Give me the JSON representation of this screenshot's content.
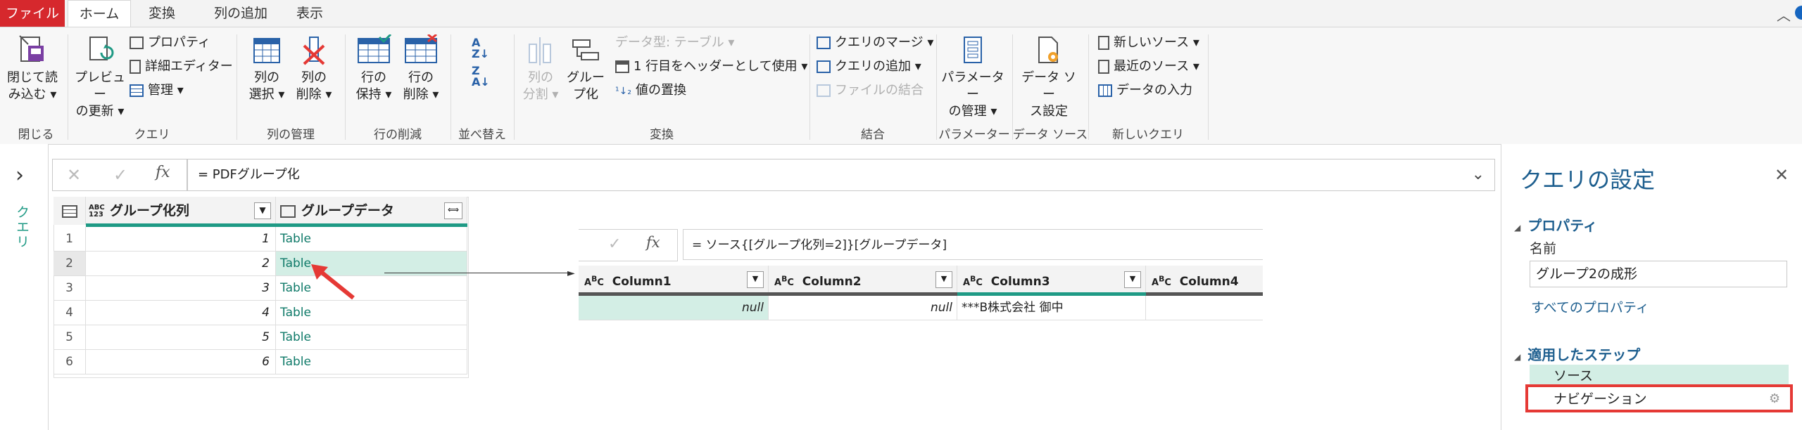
{
  "tabs": {
    "file": "ファイル",
    "home": "ホーム",
    "transform": "変換",
    "add_column": "列の追加",
    "view": "表示"
  },
  "ribbon": {
    "close": {
      "label1": "閉じて読",
      "label2": "み込む ▾",
      "group": "閉じる"
    },
    "query": {
      "preview_l1": "プレビュー",
      "preview_l2": "の更新 ▾",
      "properties": "プロパティ",
      "advanced_editor": "詳細エディター",
      "manage": "管理 ▾",
      "group": "クエリ"
    },
    "columns": {
      "choose_l1": "列の",
      "choose_l2": "選択 ▾",
      "remove_l1": "列の",
      "remove_l2": "削除 ▾",
      "group": "列の管理"
    },
    "rows": {
      "keep_l1": "行の",
      "keep_l2": "保持 ▾",
      "remove_l1": "行の",
      "remove_l2": "削除 ▾",
      "group": "行の削減"
    },
    "sort": {
      "group": "並べ替え"
    },
    "transform": {
      "split_l1": "列の",
      "split_l2": "分割 ▾",
      "groupby_l1": "グルー",
      "groupby_l2": "プ化",
      "datatype": "データ型: テーブル ▾",
      "use_header": "1 行目をヘッダーとして使用 ▾",
      "replace": "値の置換",
      "group": "変換"
    },
    "combine": {
      "merge": "クエリのマージ ▾",
      "append": "クエリの追加 ▾",
      "combine_files": "ファイルの結合",
      "group": "結合"
    },
    "params": {
      "l1": "パラメーター",
      "l2": "の管理 ▾",
      "group": "パラメーター"
    },
    "datasource": {
      "l1": "データ ソー",
      "l2": "ス設定",
      "group": "データ ソース"
    },
    "newquery": {
      "new_source": "新しいソース ▾",
      "recent": "最近のソース ▾",
      "enter_data": "データの入力",
      "group": "新しいクエリ"
    }
  },
  "nav": {
    "label": "クエリ",
    "toggle": "›"
  },
  "formula": {
    "cancel": "✕",
    "commit": "✓",
    "fx": "fx",
    "text": "= PDFグループ化"
  },
  "grid": {
    "col1_type": "ABC\n123",
    "col1": "グループ化列",
    "col2": "グループデータ",
    "rows": [
      {
        "n": "1",
        "v": "1",
        "t": "Table"
      },
      {
        "n": "2",
        "v": "2",
        "t": "Table"
      },
      {
        "n": "3",
        "v": "3",
        "t": "Table"
      },
      {
        "n": "4",
        "v": "4",
        "t": "Table"
      },
      {
        "n": "5",
        "v": "5",
        "t": "Table"
      },
      {
        "n": "6",
        "v": "6",
        "t": "Table"
      }
    ]
  },
  "preview": {
    "formula": "= ソース{[グループ化列=2]}[グループデータ]",
    "columns": [
      "Column1",
      "Column2",
      "Column3",
      "Column4"
    ],
    "row": [
      "null",
      "null",
      "***B株式会社 御中",
      ""
    ]
  },
  "settings": {
    "title": "クエリの設定",
    "close": "✕",
    "properties": "プロパティ",
    "name_label": "名前",
    "name_value": "グループ2の成形",
    "all_properties": "すべてのプロパティ",
    "applied_steps": "適用したステップ",
    "steps": [
      "ソース",
      "ナビゲーション"
    ]
  },
  "colors": {
    "accent": "#1f9a85",
    "file_tab": "#d6282d",
    "highlight": "#e53935"
  }
}
